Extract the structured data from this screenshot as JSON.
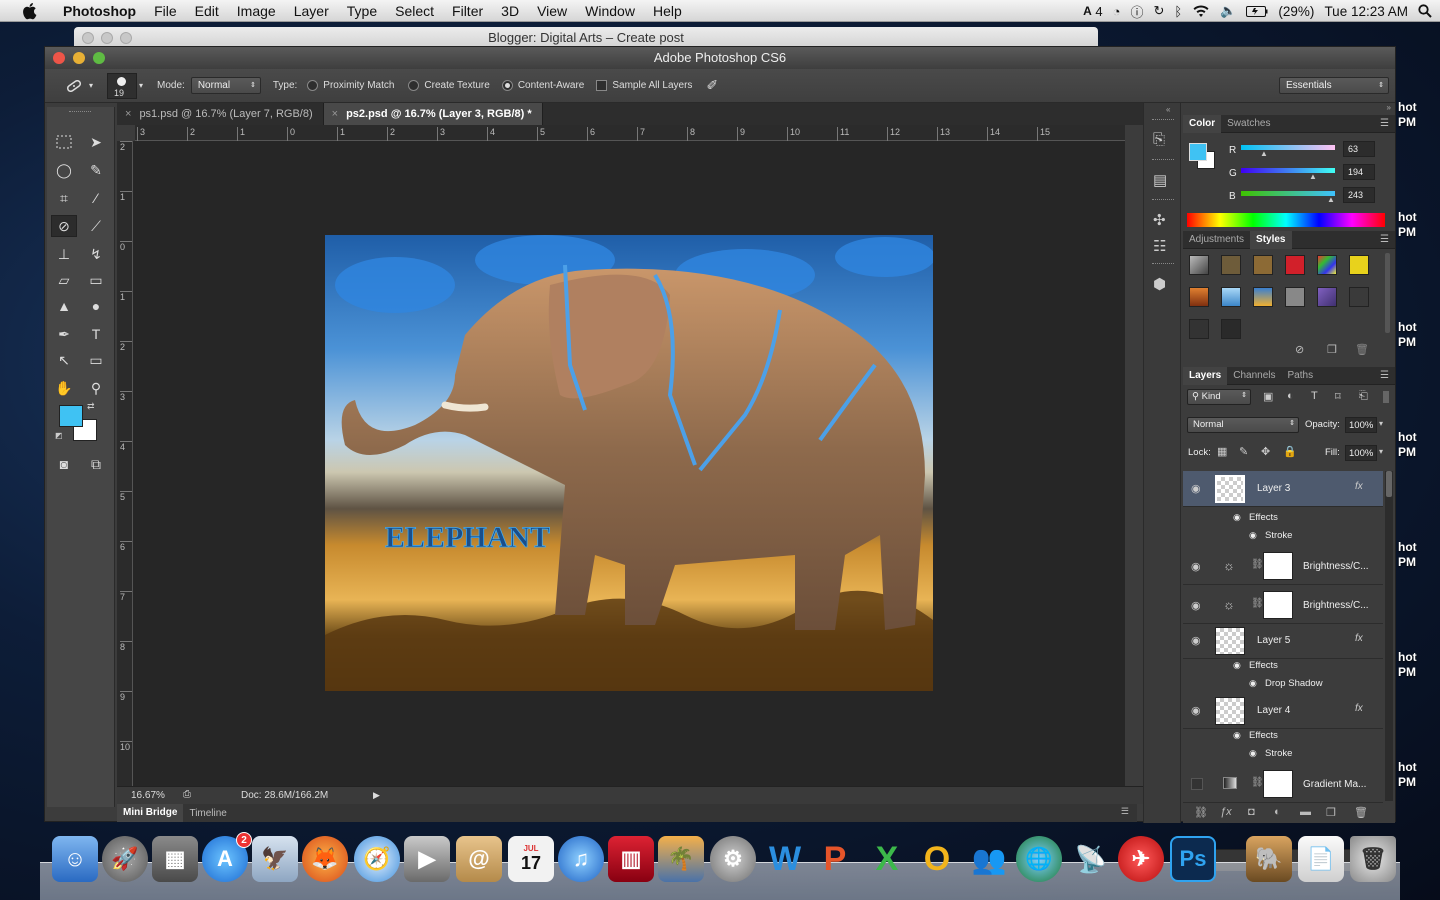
{
  "menubar": {
    "app": "Photoshop",
    "items": [
      "File",
      "Edit",
      "Image",
      "Layer",
      "Type",
      "Select",
      "Filter",
      "3D",
      "View",
      "Window",
      "Help"
    ],
    "adobe_badge": "4",
    "battery": "(29%)",
    "clock": "Tue 12:23 AM"
  },
  "desktop": {
    "thumb_label_top": "hot",
    "thumb_label_bottom": "PM"
  },
  "browser": {
    "title": "Blogger: Digital Arts – Create post"
  },
  "photoshop": {
    "title": "Adobe Photoshop CS6",
    "options": {
      "brush_size": "19",
      "mode_label": "Mode:",
      "mode_value": "Normal",
      "type_label": "Type:",
      "type_options": [
        "Proximity Match",
        "Create Texture",
        "Content-Aware"
      ],
      "type_selected": "Content-Aware",
      "sample_all": "Sample All Layers",
      "workspace": "Essentials"
    },
    "tabs": [
      {
        "label": "ps1.psd @ 16.7% (Layer 7, RGB/8)",
        "active": false
      },
      {
        "label": "ps2.psd @ 16.7% (Layer 3, RGB/8) *",
        "active": true
      }
    ],
    "ruler_h": [
      "3",
      "2",
      "1",
      "0",
      "1",
      "2",
      "3",
      "4",
      "5",
      "6",
      "7",
      "8",
      "9",
      "10",
      "11",
      "12",
      "13",
      "14",
      "15"
    ],
    "ruler_v": [
      "2",
      "1",
      "0",
      "1",
      "2",
      "3",
      "4",
      "5",
      "6",
      "7",
      "8",
      "9",
      "10"
    ],
    "document": {
      "title_text": "ELEPHANT"
    },
    "status": {
      "zoom": "16.67%",
      "doc": "Doc: 28.6M/166.2M"
    },
    "bottom_tabs": [
      "Mini Bridge",
      "Timeline"
    ],
    "colors": {
      "foreground": "#3fc2f3",
      "background": "#ffffff"
    }
  },
  "color_panel": {
    "tabs": [
      "Color",
      "Swatches"
    ],
    "r_label": "R",
    "r": "63",
    "g_label": "G",
    "g": "194",
    "b_label": "B",
    "b": "243"
  },
  "adjust_panel": {
    "tabs": [
      "Adjustments",
      "Styles"
    ]
  },
  "layers_panel": {
    "tabs": [
      "Layers",
      "Channels",
      "Paths"
    ],
    "kind": "Kind",
    "blend": "Normal",
    "opacity_label": "Opacity:",
    "opacity": "100%",
    "lock_label": "Lock:",
    "fill_label": "Fill:",
    "fill": "100%",
    "layers": [
      {
        "name": "Layer 3",
        "fx": "fx",
        "effects": "Effects",
        "effect": "Stroke"
      },
      {
        "name": "Brightness/C..."
      },
      {
        "name": "Brightness/C..."
      },
      {
        "name": "Layer 5",
        "fx": "fx",
        "effects": "Effects",
        "effect": "Drop Shadow"
      },
      {
        "name": "Layer 4",
        "fx": "fx",
        "effects": "Effects",
        "effect": "Stroke"
      },
      {
        "name": "Gradient Ma..."
      }
    ]
  },
  "dock": {
    "ical_month": "JUL",
    "ical_day": "17",
    "appstore_badge": "2",
    "ps_label": "Ps"
  }
}
